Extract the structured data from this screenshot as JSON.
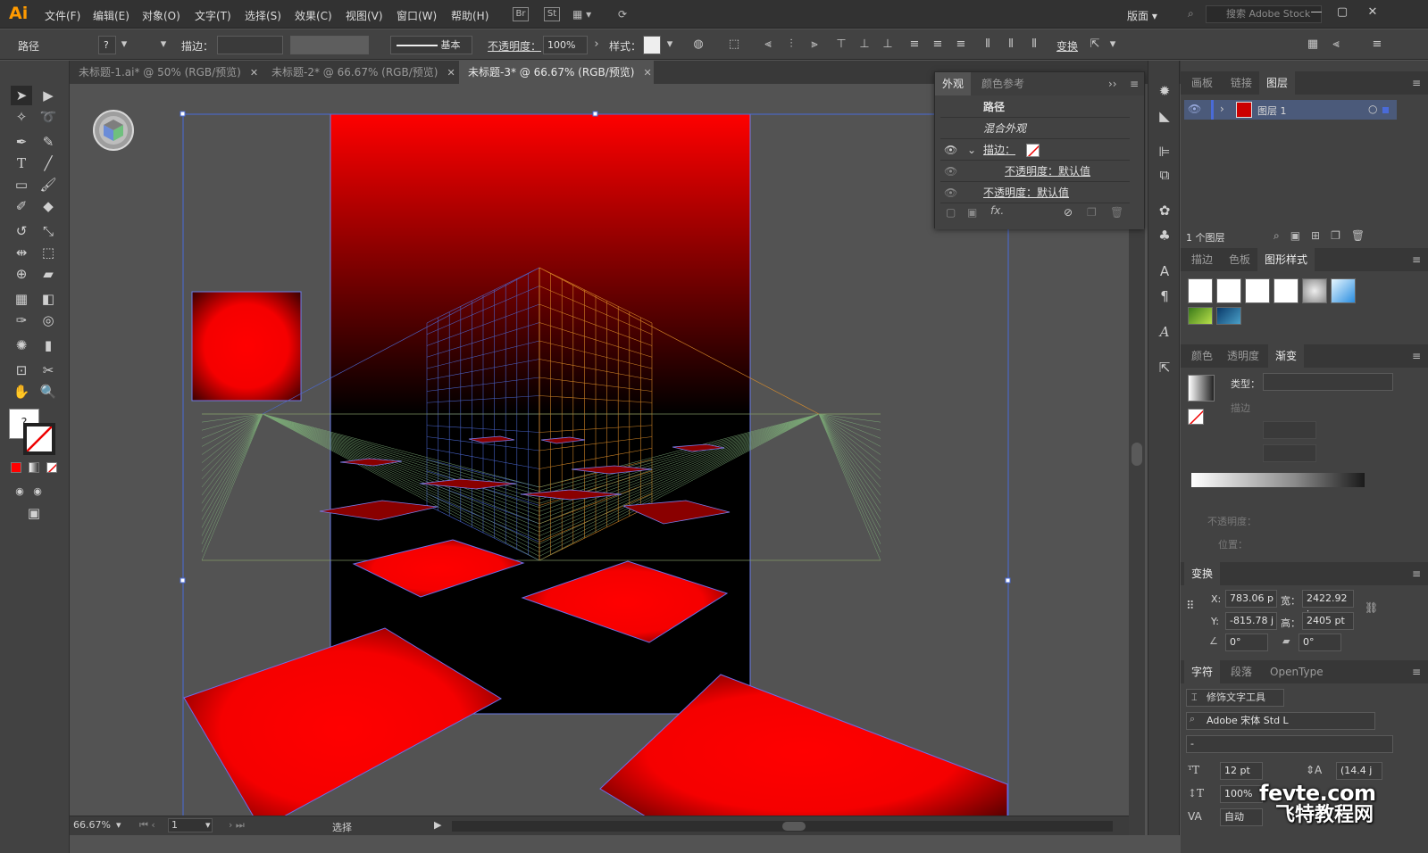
{
  "app": {
    "logo": "Ai"
  },
  "menu": [
    "文件(F)",
    "编辑(E)",
    "对象(O)",
    "文字(T)",
    "选择(S)",
    "效果(C)",
    "视图(V)",
    "窗口(W)",
    "帮助(H)"
  ],
  "menubar_right": {
    "badge_br": "Br",
    "badge_st": "St",
    "workspace": "版面",
    "search_placeholder": "搜索 Adobe Stock",
    "minimize": "—",
    "maximize": "▢",
    "close": "✕"
  },
  "control": {
    "object_type": "路径",
    "fill_value": "?",
    "stroke_label": "描边：",
    "stroke_profile": "基本",
    "opacity_label": "不透明度：",
    "opacity_value": "100%",
    "style_label": "样式：",
    "transform_label": "变换"
  },
  "tabs": [
    {
      "title": "未标题-1.ai* @ 50% (RGB/预览)",
      "active": false
    },
    {
      "title": "未标题-2* @ 66.67% (RGB/预览)",
      "active": false
    },
    {
      "title": "未标题-3* @ 66.67% (RGB/预览)",
      "active": true
    }
  ],
  "tab_close": "✕",
  "status": {
    "zoom": "66.67%",
    "artboard": "1",
    "tool": "选择"
  },
  "appearance": {
    "tab_active": "外观",
    "tab_other": "颜色参考",
    "collapse": "››",
    "object": "路径",
    "blend": "混合外观",
    "stroke_label": "描边：",
    "sub_opacity": "不透明度：默认值",
    "opacity": "不透明度：默认值",
    "fx": "fx."
  },
  "layers": {
    "tabs": [
      "画板",
      "链接",
      "图层"
    ],
    "active_tab": "图层",
    "layer_name": "图层 1",
    "count": "1 个图层"
  },
  "graphic_styles": {
    "tabs": [
      "描边",
      "色板",
      "图形样式"
    ],
    "active_tab": "图形样式"
  },
  "gradient": {
    "tabs": [
      "颜色",
      "透明度",
      "渐变"
    ],
    "active_tab": "渐变",
    "type_label": "类型：",
    "stroke_label": "描边",
    "opacity_label": "不透明度：",
    "position_label": "位置："
  },
  "transform": {
    "title": "变换",
    "x_label": "X:",
    "x": "783.06 p",
    "y_label": "Y:",
    "y": "-815.78 j",
    "w_label": "宽：",
    "w": "2422.92 j",
    "h_label": "高：",
    "h": "2405 pt",
    "angle": "0°",
    "shear": "0°"
  },
  "character": {
    "tabs": [
      "字符",
      "段落",
      "OpenType"
    ],
    "touch_tool": "修饰文字工具",
    "font": "Adobe 宋体 Std L",
    "style": "-",
    "size": "12 pt",
    "leading": "(14.4 j",
    "scale": "100%",
    "tracking": "自动"
  },
  "watermark": {
    "line1": "fevte.com",
    "line2": "飞特教程网"
  },
  "colors": {
    "accent_red": "#ff0000",
    "ui_dark": "#323232",
    "ui_mid": "#424242",
    "canvas": "#535353",
    "selection_blue": "#4a6bd8"
  }
}
